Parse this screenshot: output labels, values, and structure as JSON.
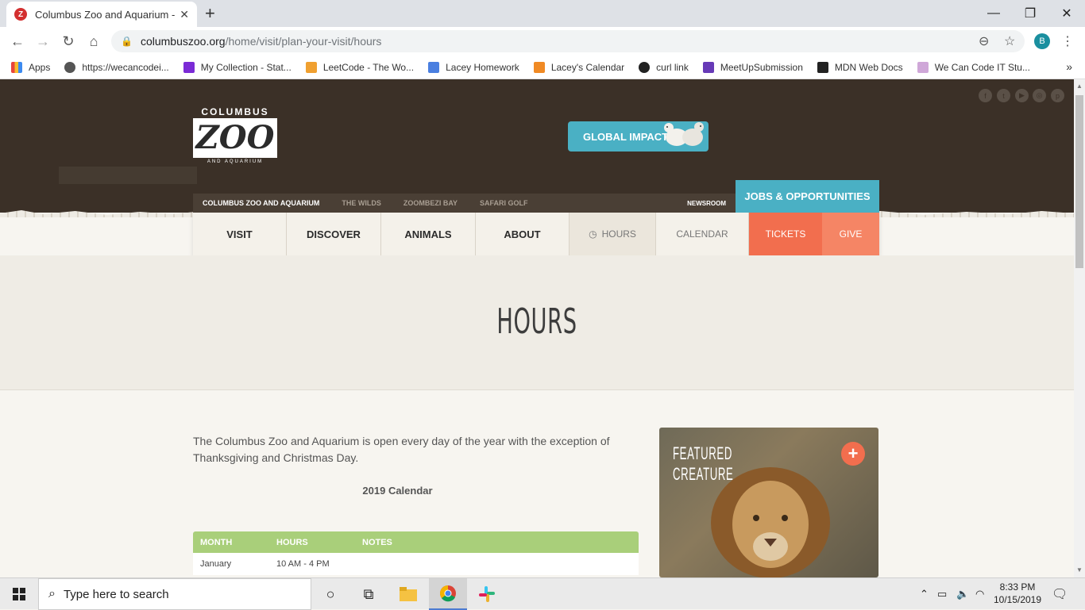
{
  "browser": {
    "tab_title": "Columbus Zoo and Aquarium - H",
    "url_host": "columbuszoo.org",
    "url_path": "/home/visit/plan-your-visit/hours",
    "profile_initial": "B"
  },
  "bookmarks": [
    {
      "label": "Apps",
      "color": "#e8453c"
    },
    {
      "label": "https://wecancodei...",
      "color": "#555555"
    },
    {
      "label": "My Collection - Stat...",
      "color": "#7b2bd6"
    },
    {
      "label": "LeetCode - The Wo...",
      "color": "#333333"
    },
    {
      "label": "Lacey Homework",
      "color": "#4a7fe0"
    },
    {
      "label": "Lacey's Calendar",
      "color": "#f08a24"
    },
    {
      "label": "curl link",
      "color": "#222222"
    },
    {
      "label": "MeetUpSubmission",
      "color": "#673ab7"
    },
    {
      "label": "MDN Web Docs",
      "color": "#222222"
    },
    {
      "label": "We Can Code IT Stu...",
      "color": "#cfa7d8"
    }
  ],
  "site": {
    "logo": {
      "top": "COLUMBUS",
      "mid": "ZOO",
      "bot": "AND AQUARIUM"
    },
    "global_impact": "GLOBAL IMPACT",
    "subnav": [
      "COLUMBUS ZOO AND AQUARIUM",
      "THE WILDS",
      "ZOOMBEZI BAY",
      "SAFARI GOLF"
    ],
    "newsroom": "NEWSROOM",
    "jobs": "JOBS & OPPORTUNITIES",
    "mainnav": {
      "visit": "VISIT",
      "discover": "DISCOVER",
      "animals": "ANIMALS",
      "about": "ABOUT",
      "hours": "HOURS",
      "calendar": "CALENDAR",
      "tickets": "TICKETS",
      "give": "GIVE"
    },
    "hero_title": "HOURS",
    "intro": "The Columbus Zoo and Aquarium is open every day of the year with the exception of Thanksgiving and Christmas Day.",
    "calendar_title": "2019 Calendar",
    "table": {
      "headers": [
        "MONTH",
        "HOURS",
        "NOTES"
      ],
      "rows": [
        {
          "month": "January",
          "hours": "10 AM - 4 PM",
          "notes": ""
        }
      ]
    },
    "featured": {
      "title": "FEATURED CREATURE",
      "plus": "+"
    }
  },
  "taskbar": {
    "search_placeholder": "Type here to search",
    "time": "8:33 PM",
    "date": "10/15/2019"
  }
}
